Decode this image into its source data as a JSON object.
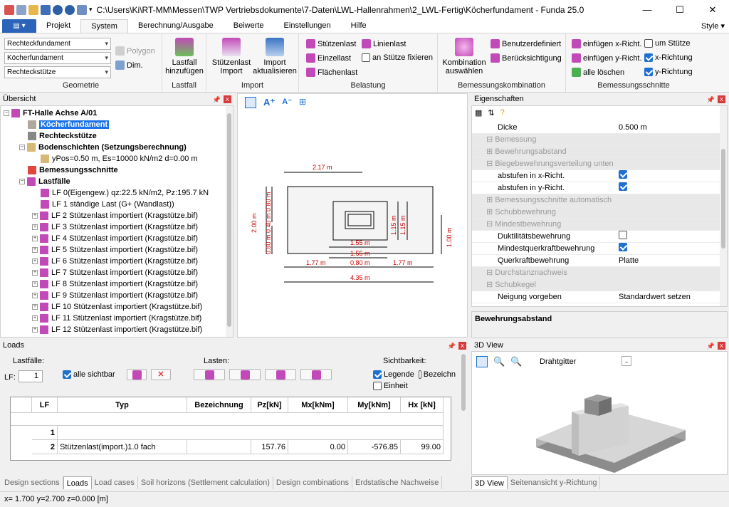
{
  "window": {
    "title": "C:\\Users\\Ki\\RT-MM\\Messen\\TWP Vertriebsdokumente\\7-Daten\\LWL-Hallenrahmen\\2_LWL-Fertig\\Köcherfundament - Funda 25.0",
    "minimize": "—",
    "maximize": "☐",
    "close": "✕"
  },
  "ribbon_tabs": [
    "Projekt",
    "System",
    "Berechnung/Ausgabe",
    "Beiwerte",
    "Einstellungen",
    "Hilfe"
  ],
  "style_label": "Style",
  "ribbon": {
    "geometrie": {
      "label": "Geometrie",
      "combo1": "Rechteckfundament",
      "combo2": "Köcherfundament",
      "combo3": "Rechteckstütze",
      "polygon": "Polygon",
      "dim": "Dim."
    },
    "lastfall": {
      "label": "Lastfall",
      "btn_line1": "Lastfall",
      "btn_line2": "hinzufügen"
    },
    "import": {
      "label": "Import",
      "btn1_line1": "Stützenlast",
      "btn1_line2": "Import",
      "btn2_line1": "Import",
      "btn2_line2": "aktualisieren"
    },
    "belastung": {
      "label": "Belastung",
      "stuetzenlast": "Stützenlast",
      "linienlast": "Linienlast",
      "einzellast": "Einzellast",
      "an_stuetze": "an Stütze fixieren",
      "flaechenlast": "Flächenlast"
    },
    "bemessungskombination": {
      "label": "Bemessungskombination",
      "btn_line1": "Kombination",
      "btn_line2": "auswählen",
      "benutzerdefiniert": "Benutzerdefiniert",
      "beruecksichtigung": "Berücksichtigung"
    },
    "bemessungsschnitte": {
      "label": "Bemessungsschnitte",
      "einfuegen_x": "einfügen x-Richt.",
      "einfuegen_y": "einfügen y-Richt.",
      "alle_loeschen": "alle löschen",
      "um_stuetze": "um Stütze",
      "x_richtung": "x-Richtung",
      "y_richtung": "y-Richtung"
    }
  },
  "overview": {
    "title": "Übersicht",
    "items": [
      {
        "label": "FT-Halle Achse A/01",
        "bold": true
      },
      {
        "label": "Köcherfundament",
        "bold": true
      },
      {
        "label": "Rechteckstütze",
        "bold": true
      },
      {
        "label": "Bodenschichten (Setzungsberechnung)",
        "bold": true
      },
      {
        "label": "yPos=0.50 m, Es=10000 kN/m2 d=0.00 m"
      },
      {
        "label": "Bemessungsschnitte",
        "bold": true
      },
      {
        "label": "Lastfälle",
        "bold": true
      },
      {
        "label": "LF 0(Eigengew.) qz:22.5 kN/m2, Pz:195.7 kN"
      },
      {
        "label": "LF 1 ständige Last (G+ (Wandlast))"
      },
      {
        "label": "LF 2 Stützenlast importiert (Kragstütze.bif)"
      },
      {
        "label": "LF 3 Stützenlast importiert (Kragstütze.bif)"
      },
      {
        "label": "LF 4 Stützenlast importiert (Kragstütze.bif)"
      },
      {
        "label": "LF 5 Stützenlast importiert (Kragstütze.bif)"
      },
      {
        "label": "LF 6 Stützenlast importiert (Kragstütze.bif)"
      },
      {
        "label": "LF 7 Stützenlast importiert (Kragstütze.bif)"
      },
      {
        "label": "LF 8 Stützenlast importiert (Kragstütze.bif)"
      },
      {
        "label": "LF 9 Stützenlast importiert (Kragstütze.bif)"
      },
      {
        "label": "LF 10 Stützenlast importiert (Kragstütze.bif)"
      },
      {
        "label": "LF 11 Stützenlast importiert (Kragstütze.bif)"
      },
      {
        "label": "LF 12 Stützenlast importiert (Kragstütze.bif)"
      }
    ]
  },
  "drawing": {
    "dim_top": "2.17 m",
    "dim_155a": "1.55 m",
    "dim_155b": "1.55 m",
    "dim_177a": "1.77 m",
    "dim_080": "0.80 m",
    "dim_177b": "1.77 m",
    "dim_435": "4.35 m",
    "dim_200": "2.00 m",
    "dim_080v1": "0.80 m",
    "dim_040": "0.40 m",
    "dim_080v2": "0.80 m",
    "dim_115a": "1.15 m",
    "dim_115b": "1.15 m",
    "dim_100": "1.00 m"
  },
  "properties": {
    "title": "Eigenschaften",
    "rows": [
      {
        "type": "prop",
        "name": "Dicke",
        "value": "0.500 m"
      },
      {
        "type": "cat",
        "name": "Bemessung"
      },
      {
        "type": "sub",
        "name": "Bewehrungsabstand"
      },
      {
        "type": "sub",
        "name": "Biegebewehrungsverteilung unten"
      },
      {
        "type": "prop",
        "name": "abstufen in x-Richt.",
        "check": true
      },
      {
        "type": "prop",
        "name": "abstufen in y-Richt.",
        "check": true
      },
      {
        "type": "sub",
        "name": "Bemessungsschnitte automatisch"
      },
      {
        "type": "sub",
        "name": "Schubbewehrung"
      },
      {
        "type": "sub",
        "name": "Mindestbewehrung"
      },
      {
        "type": "prop",
        "name": "Duktilitätsbewehrung",
        "check": false
      },
      {
        "type": "prop",
        "name": "Mindestquerkraftbewehrung",
        "check": true
      },
      {
        "type": "prop",
        "name": "Querkraftbewehrung",
        "value": "Platte"
      },
      {
        "type": "cat",
        "name": "Durchstanznachweis"
      },
      {
        "type": "sub",
        "name": "Schubkegel"
      },
      {
        "type": "prop",
        "name": "Neigung vorgeben",
        "value": "Standardwert setzen"
      }
    ],
    "description": "Bewehrungsabstand"
  },
  "loads": {
    "title": "Loads",
    "lastfaelle_label": "Lastfälle:",
    "lf_label": "LF:",
    "lf_value": "1",
    "alle_sichtbar": "alle sichtbar",
    "lasten_label": "Lasten:",
    "sichtbarkeit_label": "Sichtbarkeit:",
    "legende": "Legende",
    "bezeichn": "Bezeichn",
    "einheit": "Einheit",
    "columns": [
      "LF",
      "Typ",
      "Bezeichnung",
      "Pz[kN]",
      "Mx[kNm]",
      "My[kNm]",
      "Hx [kN]"
    ],
    "rows": [
      {
        "lf": "1",
        "typ": "",
        "bez": "",
        "pz": "",
        "mx": "",
        "my": "",
        "hx": ""
      },
      {
        "lf": "2",
        "typ": "Stützenlast(import.)1.0 fach",
        "bez": "",
        "pz": "157.76",
        "mx": "0.00",
        "my": "-576.85",
        "hx": "99.00"
      }
    ]
  },
  "bottom_tabs_left": [
    "Design sections",
    "Loads",
    "Load cases",
    "Soil horizons (Settlement calculation)",
    "Design combinations",
    "Erdstatische Nachweise"
  ],
  "view3d": {
    "title": "3D View",
    "mode": "Drahtgitter",
    "tabs": [
      "3D View",
      "Seitenansicht y-Richtung"
    ]
  },
  "status": {
    "text": "x= 1.700  y=2.700  z=0.000 [m]"
  }
}
